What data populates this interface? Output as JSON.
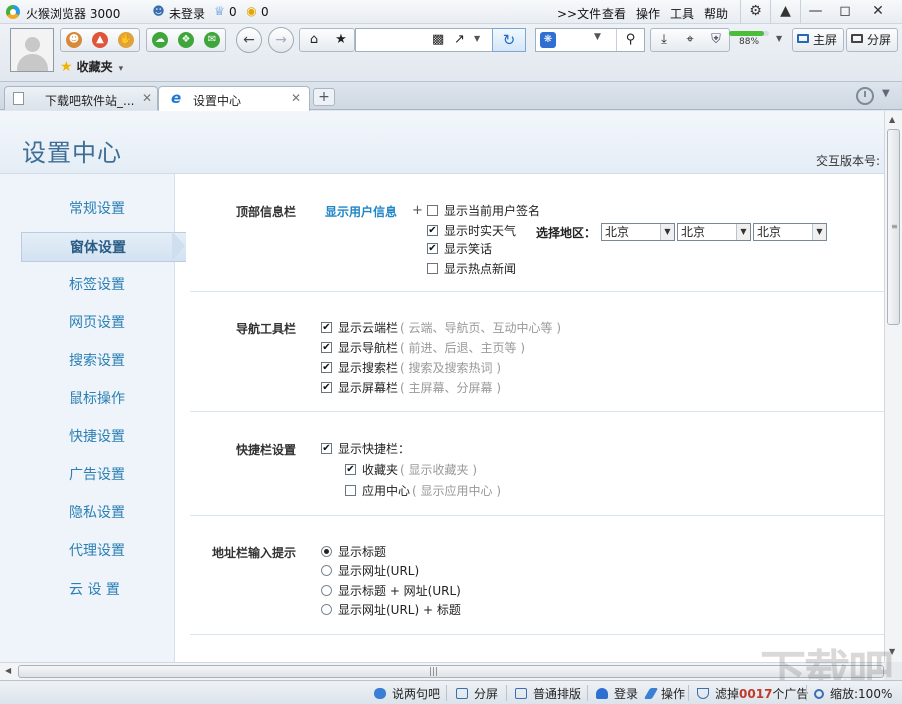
{
  "titlebar": {
    "app_name": "火猴浏览器 3000",
    "user_status": "未登录",
    "crown_count": "0",
    "coin_count": "0",
    "menus": [
      ">>文件",
      "查看",
      "操作",
      "工具",
      "帮助"
    ]
  },
  "toolbar": {
    "favorites_label": "收藏夹",
    "battery_percent": "88%",
    "battery_level": 0.88,
    "main_screen_label": "主屏",
    "split_screen_label": "分屏"
  },
  "tabs": [
    {
      "label": "下载吧软件站_...",
      "active": false
    },
    {
      "label": "设置中心",
      "active": true
    }
  ],
  "page": {
    "title": "设置中心",
    "version_label": "交互版本号:"
  },
  "sidebar": {
    "items": [
      {
        "label": "常规设置",
        "active": false
      },
      {
        "label": "窗体设置",
        "active": true
      },
      {
        "label": "标签设置",
        "active": false
      },
      {
        "label": "网页设置",
        "active": false
      },
      {
        "label": "搜索设置",
        "active": false
      },
      {
        "label": "鼠标操作",
        "active": false
      },
      {
        "label": "快捷设置",
        "active": false
      },
      {
        "label": "广告设置",
        "active": false
      },
      {
        "label": "隐私设置",
        "active": false
      },
      {
        "label": "代理设置",
        "active": false
      },
      {
        "label": "云 设 置",
        "active": false
      }
    ]
  },
  "sections": {
    "top_info": {
      "label": "顶部信息栏",
      "show_user_info": "显示用户信息",
      "plus": "+",
      "options": [
        {
          "label": "显示当前用户签名",
          "checked": false
        },
        {
          "label": "显示时实天气",
          "checked": true
        },
        {
          "label": "显示笑话",
          "checked": true
        },
        {
          "label": "显示热点新闻",
          "checked": false
        }
      ],
      "region_label": "选择地区：",
      "regions": [
        "北京",
        "北京",
        "北京"
      ]
    },
    "nav_toolbar": {
      "label": "导航工具栏",
      "options": [
        {
          "label": "显示云端栏",
          "hint": "( 云端、导航页、互动中心等 )",
          "checked": true
        },
        {
          "label": "显示导航栏",
          "hint": "( 前进、后退、主页等 )",
          "checked": true
        },
        {
          "label": "显示搜索栏",
          "hint": "( 搜索及搜索热词 )",
          "checked": true
        },
        {
          "label": "显示屏幕栏",
          "hint": "( 主屏幕、分屏幕 )",
          "checked": true
        }
      ]
    },
    "quickbar": {
      "label": "快捷栏设置",
      "main": {
        "label": "显示快捷栏：",
        "checked": true
      },
      "options": [
        {
          "label": "收藏夹",
          "hint": "( 显示收藏夹 )",
          "checked": true
        },
        {
          "label": "应用中心",
          "hint": "( 显示应用中心 )",
          "checked": false
        }
      ]
    },
    "address_hint": {
      "label": "地址栏输入提示",
      "options": [
        {
          "label": "显示标题",
          "selected": true
        },
        {
          "label": "显示网址(URL)",
          "selected": false
        },
        {
          "label": "显示标题 + 网址(URL)",
          "selected": false
        },
        {
          "label": "显示网址(URL) + 标题",
          "selected": false
        }
      ]
    }
  },
  "statusbar": {
    "chat": "说两句吧",
    "split": "分屏",
    "layout": "普通排版",
    "login": "登录",
    "ops": "操作",
    "filter_prefix": "滤掉",
    "filter_count": "0017",
    "filter_suffix": "个广告",
    "zoom": "缩放:100%"
  },
  "watermark": "下载吧",
  "colors": {
    "accent_blue": "#1f86c8",
    "nav_text": "#2b7fb3",
    "title_blue": "#3f6e95",
    "counter_red": "#c0392b"
  }
}
